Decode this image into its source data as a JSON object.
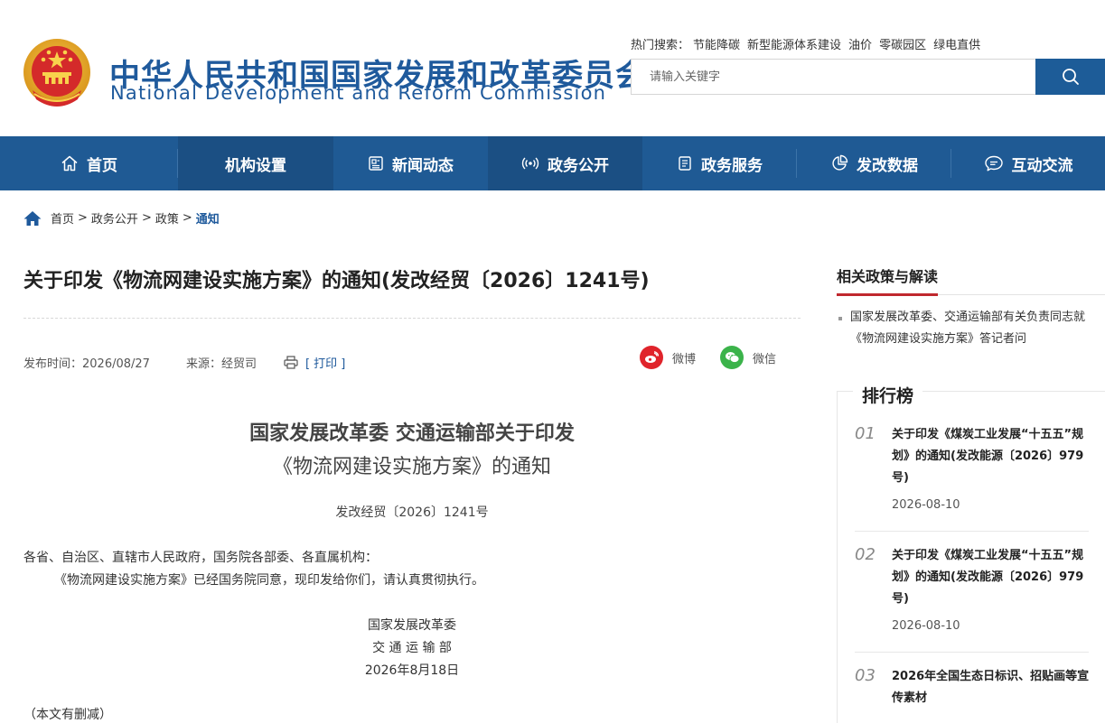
{
  "header": {
    "title_cn": "中华人民共和国国家发展和改革委员会",
    "title_en": "National Development and Reform Commission",
    "hot_search_label": "热门搜索：",
    "hot_keywords": [
      "节能降碳",
      "新型能源体系建设",
      "油价",
      "零碳园区",
      "绿电直供"
    ],
    "search_placeholder": "请输入关键字"
  },
  "nav": {
    "items": [
      {
        "label": "首页",
        "icon": "home-icon"
      },
      {
        "label": "机构设置",
        "icon": ""
      },
      {
        "label": "新闻动态",
        "icon": "news-icon"
      },
      {
        "label": "政务公开",
        "icon": "broadcast-icon"
      },
      {
        "label": "政务服务",
        "icon": "document-icon"
      },
      {
        "label": "发改数据",
        "icon": "pie-chart-icon"
      },
      {
        "label": "互动交流",
        "icon": "chat-icon"
      }
    ]
  },
  "breadcrumb": {
    "items": [
      "首页",
      "政务公开",
      "政策"
    ],
    "current": "通知"
  },
  "article": {
    "title": "关于印发《物流网建设实施方案》的通知(发改经贸〔2026〕1241号)",
    "publish_time": "发布时间：2026/08/27",
    "source": "来源：经贸司",
    "print_label": "[ 打印 ]",
    "share_weibo": "微博",
    "share_wechat": "微信",
    "doc_title_line1": "国家发展改革委 交通运输部关于印发",
    "doc_title_line2": "《物流网建设实施方案》的通知",
    "doc_number": "发改经贸〔2026〕1241号",
    "salutation": "各省、自治区、直辖市人民政府，国务院各部委、各直属机构：",
    "body": "《物流网建设实施方案》已经国务院同意，现印发给你们，请认真贯彻执行。",
    "signer1": "国家发展改革委",
    "signer2": "交 通 运 输 部",
    "sign_date": "2026年8月18日",
    "note": "（本文有删减）"
  },
  "sidebar": {
    "related_title": "相关政策与解读",
    "related_items": [
      "国家发展改革委、交通运输部有关负责同志就《物流网建设实施方案》答记者问"
    ],
    "ranking_title": "排行榜",
    "ranking": [
      {
        "num": "01",
        "title": "关于印发《煤炭工业发展“十五五”规划》的通知(发改能源〔2026〕979号)",
        "date": "2026-08-10"
      },
      {
        "num": "02",
        "title": "关于印发《煤炭工业发展“十五五”规划》的通知(发改能源〔2026〕979号)",
        "date": "2026-08-10"
      },
      {
        "num": "03",
        "title": "2026年全国生态日标识、招贴画等宣传素材",
        "date": ""
      }
    ]
  },
  "colors": {
    "brand_blue": "#1f5a94",
    "accent_red": "#c0282e",
    "weibo_red": "#e0242b",
    "wechat_green": "#3bb34a"
  }
}
